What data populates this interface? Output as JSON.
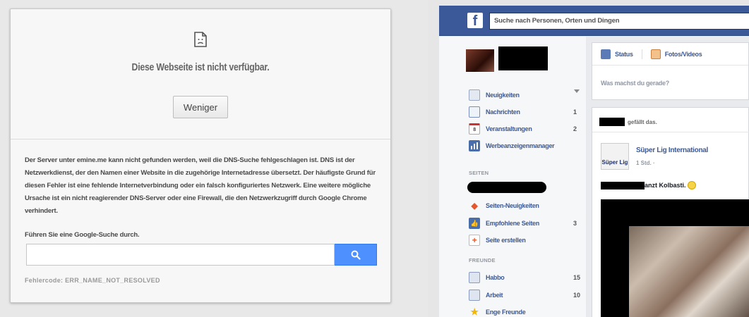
{
  "chrome_error": {
    "title": "Diese Webseite ist nicht verfügbar.",
    "less_button": "Weniger",
    "description": "Der Server unter emine.me kann nicht gefunden werden, weil die DNS-Suche fehlgeschlagen ist. DNS ist der Netzwerkdienst, der den Namen einer Website in die zugehörige Internetadresse übersetzt. Der häufigste Grund für diesen Fehler ist eine fehlende Internetverbindung oder ein falsch konfiguriertes Netzwerk. Eine weitere mögliche Ursache ist ein nicht reagierender DNS-Server oder eine Firewall, die den Netzwerkzugriff durch Google Chrome verhindert.",
    "search_hint": "Führen Sie eine Google-Suche durch.",
    "search_value": "",
    "error_code": "Fehlercode: ERR_NAME_NOT_RESOLVED",
    "accent_color": "#4d90fe"
  },
  "facebook": {
    "logo": "f",
    "search_placeholder": "Suche nach Personen, Orten und Dingen",
    "sidebar": {
      "items": [
        {
          "label": "Neuigkeiten",
          "icon": "news-feed-icon",
          "count": ""
        },
        {
          "label": "Nachrichten",
          "icon": "messages-icon",
          "count": "1"
        },
        {
          "label": "Veranstaltungen",
          "icon": "events-icon",
          "count": "2"
        },
        {
          "label": "Werbeanzeigenmanager",
          "icon": "ads-manager-icon",
          "count": ""
        }
      ],
      "pages_section": "SEITEN",
      "pages_items": [
        {
          "label": "Seiten-Neuigkeiten",
          "icon": "pages-feed-icon",
          "count": ""
        },
        {
          "label": "Empfohlene Seiten",
          "icon": "like-pages-icon",
          "count": "3"
        },
        {
          "label": "Seite erstellen",
          "icon": "create-page-icon",
          "count": ""
        }
      ],
      "friends_section": "FREUNDE",
      "friends_items": [
        {
          "label": "Habbo",
          "icon": "friend-list-icon",
          "count": "15"
        },
        {
          "label": "Arbeit",
          "icon": "friend-list-icon",
          "count": "10"
        },
        {
          "label": "Enge Freunde",
          "icon": "star-icon",
          "count": ""
        }
      ]
    },
    "composer": {
      "tab_status": "Status",
      "tab_photos": "Fotos/Videos",
      "placeholder": "Was machst du gerade?"
    },
    "post": {
      "story_suffix": "gefällt das.",
      "avatar_text": "Süper Lig",
      "author": "Süper Lig International",
      "meta": "1 Std. ·",
      "text_suffix": "anzt Kolbasti."
    },
    "brand_color": "#3b5998"
  }
}
